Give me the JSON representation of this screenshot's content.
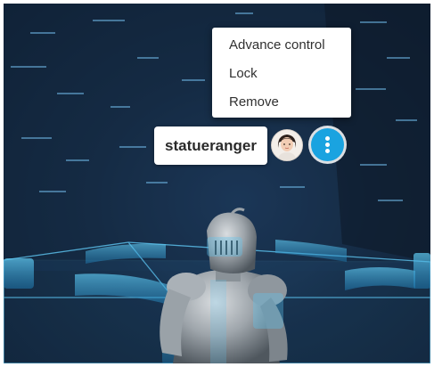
{
  "context_menu": {
    "items": [
      {
        "label": "Advance control"
      },
      {
        "label": "Lock"
      },
      {
        "label": "Remove"
      }
    ]
  },
  "user": {
    "username": "statueranger",
    "avatar_icon": "user-avatar"
  },
  "more_button": {
    "icon": "more-vertical-icon",
    "color": "#1aa3e0"
  },
  "scene": {
    "object": "knight-statue",
    "accent_color": "#3fb6e8"
  }
}
